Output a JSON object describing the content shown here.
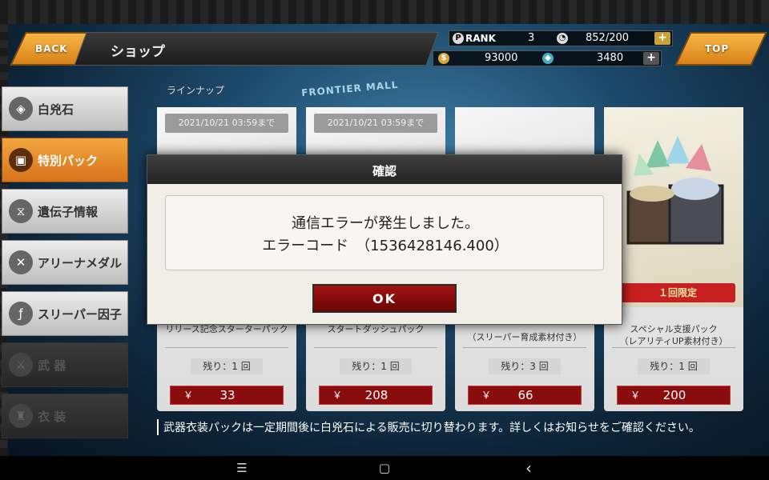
{
  "header": {
    "back_label": "BACK",
    "title": "ショップ",
    "top_label": "TOP"
  },
  "status": {
    "rank_label": "RANK",
    "rank_value": "3",
    "stamina": "852/200",
    "gold": "93000",
    "gems": "3480"
  },
  "sidebar": {
    "items": [
      {
        "label": "白兇石"
      },
      {
        "label": "特別パック"
      },
      {
        "label": "遺伝子情報"
      },
      {
        "label": "アリーナメダル"
      },
      {
        "label": "スリーパー因子"
      },
      {
        "label": "武 器"
      },
      {
        "label": "衣 装"
      }
    ]
  },
  "lineup": {
    "label": "ラインナップ",
    "banner_text": "FRONTIER MALL",
    "cards": [
      {
        "date": "2021/10/21 03:59まで",
        "name": "リリース記念スターターパック",
        "remain_label": "残り：",
        "remain_value": "1",
        "remain_unit": "回",
        "yen": "￥",
        "price": "33"
      },
      {
        "date": "2021/10/21 03:59まで",
        "name": "スタートダッシュパック",
        "remain_label": "残り：",
        "remain_value": "1",
        "remain_unit": "回",
        "yen": "￥",
        "price": "208"
      },
      {
        "date": "",
        "name": "（スリーパー育成素材付き）",
        "remain_label": "残り：",
        "remain_value": "3",
        "remain_unit": "回",
        "yen": "￥",
        "price": "66"
      },
      {
        "date": "",
        "limit": "１回限定",
        "name": "スペシャル支援パック\n（レアリティUP素材付き）",
        "remain_label": "残り：",
        "remain_value": "1",
        "remain_unit": "回",
        "yen": "￥",
        "price": "200"
      }
    ],
    "notice": "武器衣装パックは一定期間後に白兇石による販売に切り替わります。詳しくはお知らせをご確認ください。"
  },
  "dialog": {
    "title": "確認",
    "line1": "通信エラーが発生しました。",
    "line2": "エラーコード　（1536428146.400）",
    "ok_label": "OK"
  },
  "navbar": {
    "menu_icon": "☰",
    "home_icon": "▢",
    "back_icon": "‹"
  },
  "colors": {
    "accent_orange": "#f7b545",
    "price_red": "#8a0d0d",
    "dialog_bg": "#f1eee7"
  }
}
